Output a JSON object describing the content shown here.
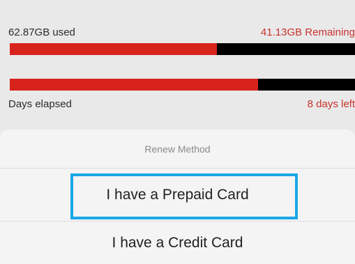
{
  "usage": {
    "data_used_label": "62.87GB used",
    "data_remaining_label": "41.13GB Remaining",
    "data_progress": 0.6,
    "days_progress": 0.72,
    "days_elapsed_label": "Days elapsed",
    "days_left_label": "8 days left"
  },
  "colors": {
    "accent_red": "#d8231c",
    "highlight_blue": "#1ba7e6"
  },
  "sheet": {
    "title": "Renew Method",
    "options": [
      {
        "label": "I have a Prepaid Card"
      },
      {
        "label": "I have a Credit Card"
      }
    ]
  }
}
